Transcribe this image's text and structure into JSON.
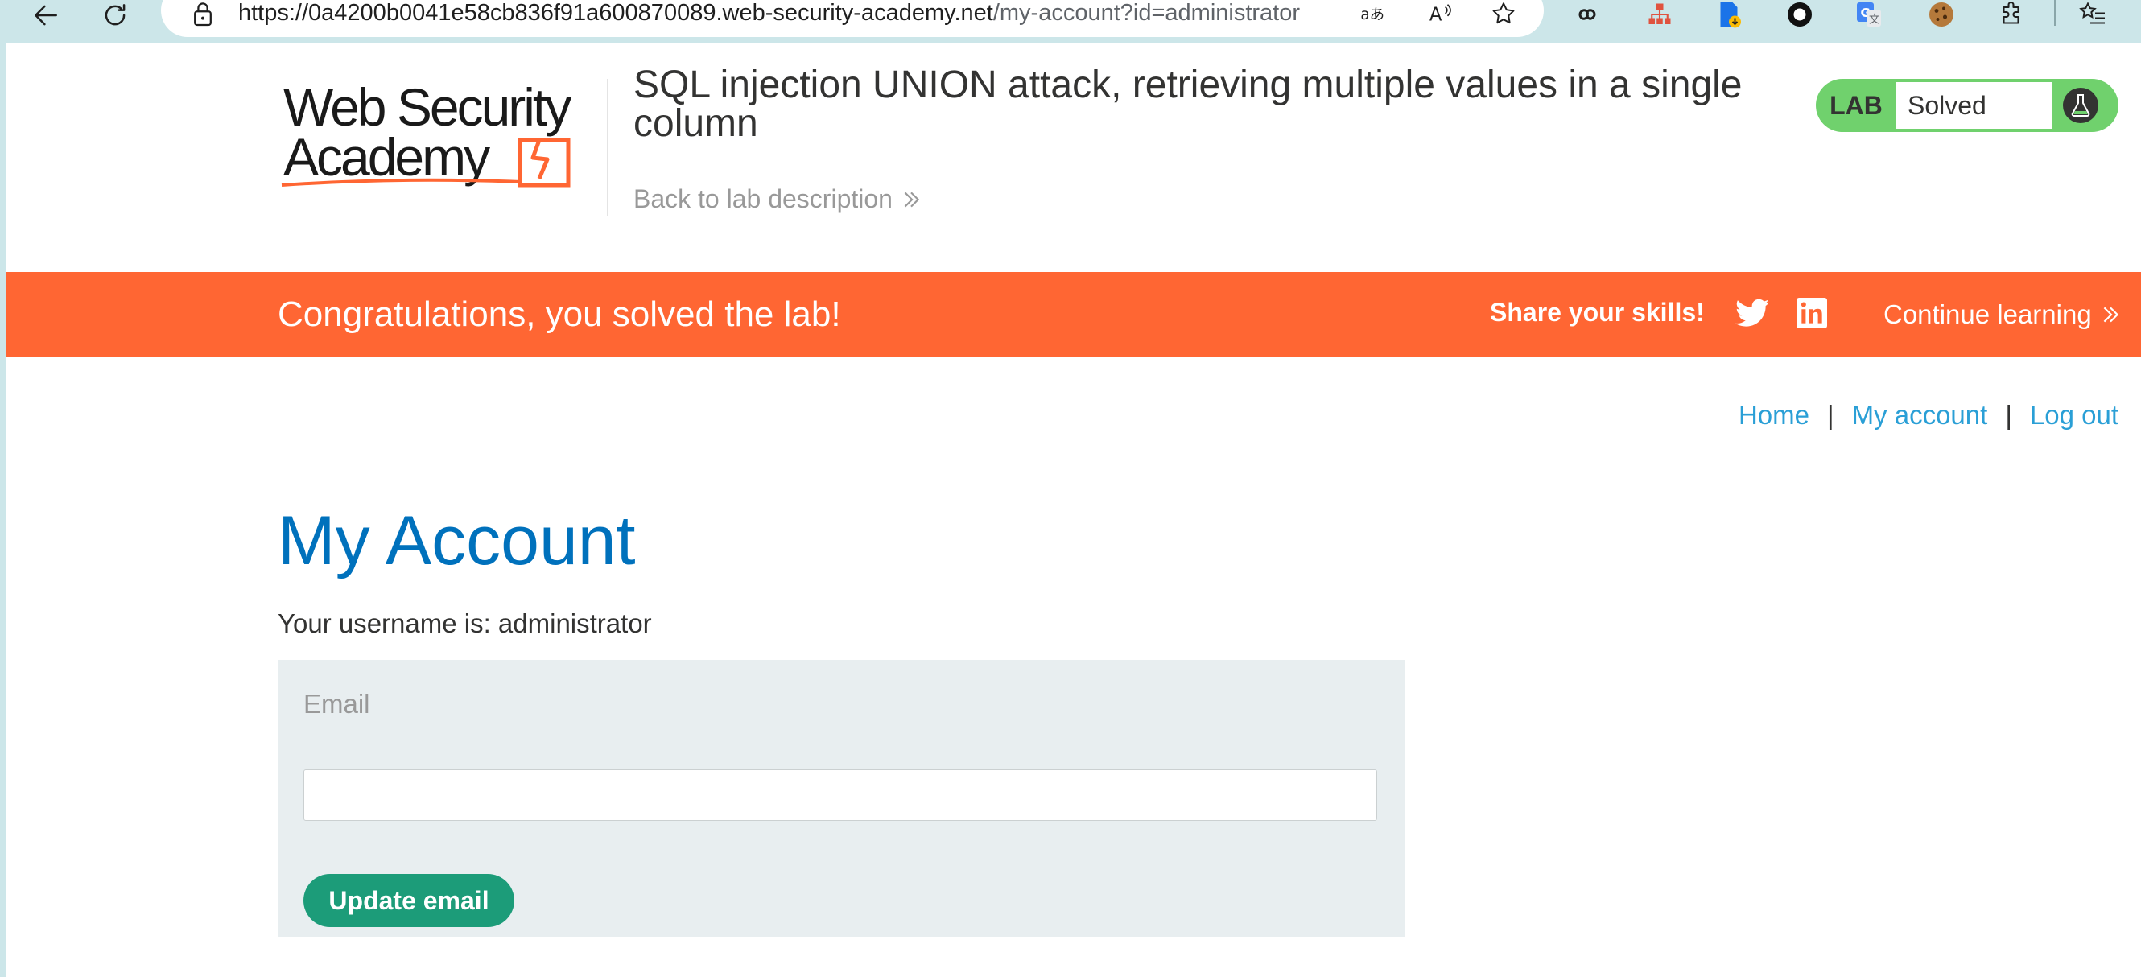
{
  "browser": {
    "url_host": "https://0a4200b0041e58cb836f91a600870089.web-security-academy.net",
    "url_path": "/my-account?id=administrator",
    "icons": [
      "back-arrow-icon",
      "refresh-icon",
      "lock-icon",
      "translate-icon",
      "read-aloud-icon",
      "favorite-star-icon",
      "infinity-icon",
      "org-chart-icon",
      "document-download-icon",
      "circle-icon",
      "google-translate-icon",
      "cookie-icon",
      "extensions-puzzle-icon",
      "favorites-list-icon"
    ]
  },
  "header": {
    "logo_line1": "Web Security",
    "logo_line2": "Academy",
    "lab_title": "SQL injection UNION attack, retrieving multiple values in a single column",
    "back_link": "Back to lab description",
    "lab_badge": "LAB",
    "lab_status": "Solved"
  },
  "banner": {
    "message": "Congratulations, you solved the lab!",
    "share": "Share your skills!",
    "continue": "Continue learning"
  },
  "nav": {
    "home": "Home",
    "separator": "|",
    "my_account": "My account",
    "log_out": "Log out"
  },
  "main": {
    "heading": "My Account",
    "username_line": "Your username is: administrator",
    "email_label": "Email",
    "email_value": "",
    "update_button": "Update email"
  },
  "colors": {
    "chrome_bg": "#cce6e9",
    "banner_orange": "#ff6633",
    "lab_green": "#70d16d",
    "heading_blue": "#0071bc",
    "link_blue": "#2a9fd6",
    "button_green": "#1c9c79",
    "form_bg": "#e8eef0"
  }
}
